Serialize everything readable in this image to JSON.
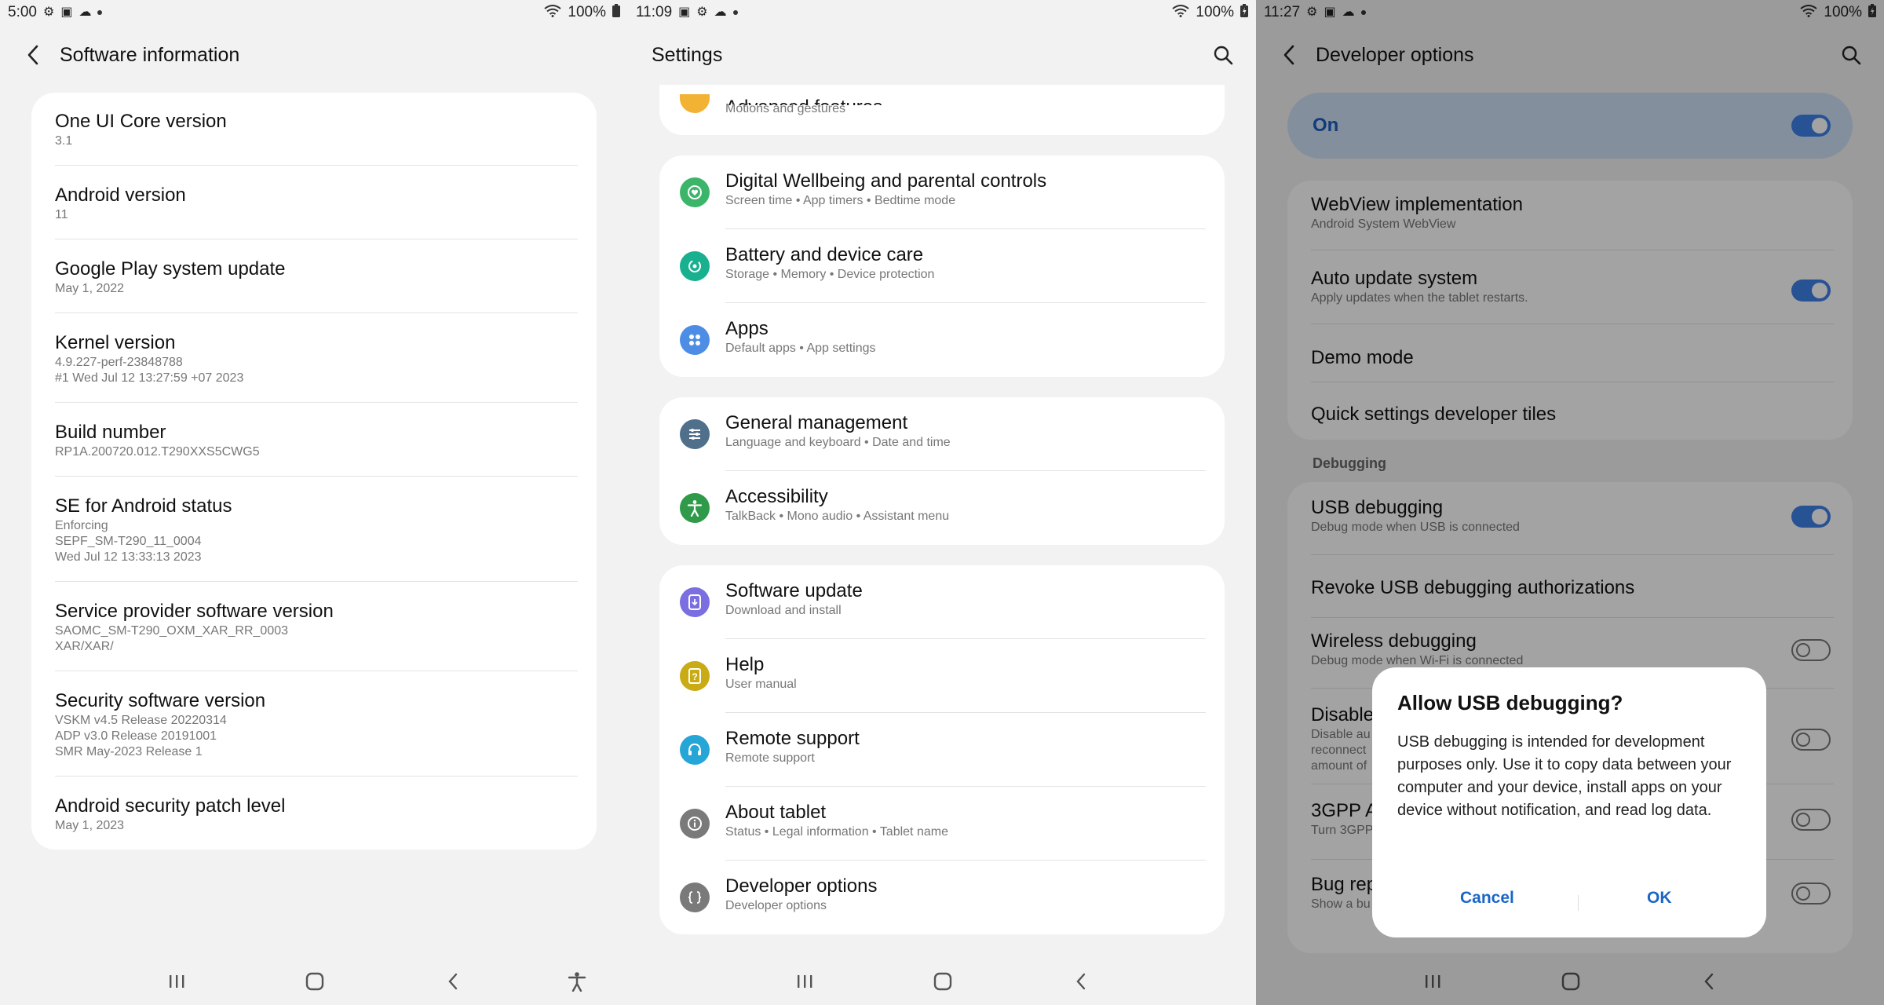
{
  "screen1": {
    "status": {
      "time": "5:00",
      "battery": "100%"
    },
    "header": {
      "title": "Software information"
    },
    "items": [
      {
        "title": "One UI Core version",
        "sub": [
          "3.1"
        ]
      },
      {
        "title": "Android version",
        "sub": [
          "11"
        ]
      },
      {
        "title": "Google Play system update",
        "sub": [
          "May 1, 2022"
        ]
      },
      {
        "title": "Kernel version",
        "sub": [
          "4.9.227-perf-23848788",
          "#1 Wed Jul 12 13:27:59 +07 2023"
        ]
      },
      {
        "title": "Build number",
        "sub": [
          "RP1A.200720.012.T290XXS5CWG5"
        ]
      },
      {
        "title": "SE for Android status",
        "sub": [
          "Enforcing",
          "SEPF_SM-T290_11_0004",
          "Wed Jul 12 13:33:13 2023"
        ]
      },
      {
        "title": "Service provider software version",
        "sub": [
          "SAOMC_SM-T290_OXM_XAR_RR_0003",
          "XAR/XAR/"
        ]
      },
      {
        "title": "Security software version",
        "sub": [
          "VSKM v4.5 Release 20220314",
          "ADP v3.0 Release 20191001",
          "SMR May-2023 Release 1"
        ]
      },
      {
        "title": "Android security patch level",
        "sub": [
          "May 1, 2023"
        ]
      }
    ]
  },
  "screen2": {
    "status": {
      "time": "11:09",
      "battery": "100%"
    },
    "header": {
      "title": "Settings"
    },
    "partial": {
      "title": "Advanced features",
      "sub": "Motions and gestures"
    },
    "groups": [
      [
        {
          "title": "Digital Wellbeing and parental controls",
          "sub": "Screen time  •  App timers  •  Bedtime mode",
          "icon": "wellbeing-icon",
          "color": "#3cb56a"
        },
        {
          "title": "Battery and device care",
          "sub": "Storage  •  Memory  •  Device protection",
          "icon": "device-care-icon",
          "color": "#19b08f"
        },
        {
          "title": "Apps",
          "sub": "Default apps  •  App settings",
          "icon": "apps-icon",
          "color": "#4d8de6"
        }
      ],
      [
        {
          "title": "General management",
          "sub": "Language and keyboard  •  Date and time",
          "icon": "general-management-icon",
          "color": "#4f6f8a"
        },
        {
          "title": "Accessibility",
          "sub": "TalkBack  •  Mono audio  •  Assistant menu",
          "icon": "accessibility-icon",
          "color": "#2f9a4a"
        }
      ],
      [
        {
          "title": "Software update",
          "sub": "Download and install",
          "icon": "software-update-icon",
          "color": "#7a6ee0"
        },
        {
          "title": "Help",
          "sub": "User manual",
          "icon": "help-icon",
          "color": "#c9ab15"
        },
        {
          "title": "Remote support",
          "sub": "Remote support",
          "icon": "remote-support-icon",
          "color": "#26a6d6"
        },
        {
          "title": "About tablet",
          "sub": "Status  •  Legal information  •  Tablet name",
          "icon": "info-icon",
          "color": "#7a7a7a"
        },
        {
          "title": "Developer options",
          "sub": "Developer options",
          "icon": "developer-options-icon",
          "color": "#7a7a7a"
        }
      ]
    ]
  },
  "screen3": {
    "status": {
      "time": "11:27",
      "battery": "100%"
    },
    "header": {
      "title": "Developer options"
    },
    "master": {
      "label": "On"
    },
    "items": [
      {
        "title": "WebView implementation",
        "sub": "Android System WebView"
      },
      {
        "title": "Auto update system",
        "sub": "Apply updates when the tablet restarts."
      },
      {
        "title": "Demo mode",
        "sub": ""
      },
      {
        "title": "Quick settings developer tiles",
        "sub": ""
      }
    ],
    "section": "Debugging",
    "debug": [
      {
        "title": "USB debugging",
        "sub": "Debug mode when USB is connected"
      },
      {
        "title": "Revoke USB debugging authorizations",
        "sub": ""
      },
      {
        "title": "Wireless debugging",
        "sub": "Debug mode when Wi-Fi is connected"
      },
      {
        "title": "Disable",
        "sub": [
          "Disable au",
          "reconnect",
          "amount of"
        ]
      },
      {
        "title": "3GPP A",
        "sub": "Turn 3GPP"
      },
      {
        "title": "Bug rep",
        "sub": "Show a bu"
      }
    ],
    "dialog": {
      "title": "Allow USB debugging?",
      "body": "USB debugging is intended for development purposes only. Use it to copy data between your computer and your device, install apps on your device without notification, and read log data.",
      "cancel": "Cancel",
      "ok": "OK"
    }
  }
}
